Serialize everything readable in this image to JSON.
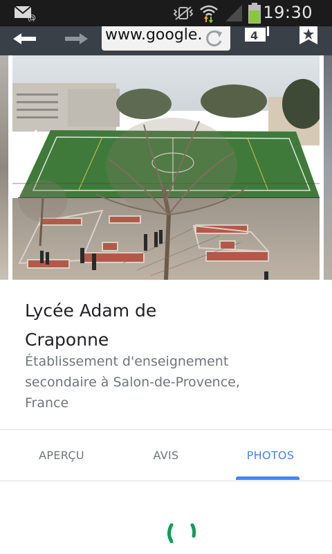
{
  "status_bar": {
    "time": "19:30",
    "icons": [
      "email-notification-icon",
      "vibrate-icon",
      "wifi-icon",
      "signal-icon",
      "battery-icon"
    ],
    "battery_color": "#8cc63f"
  },
  "browser": {
    "url": "www.google.",
    "tab_count": "4",
    "icons": [
      "back-arrow-icon",
      "forward-arrow-icon",
      "reload-icon",
      "tabs-icon",
      "bookmark-icon"
    ]
  },
  "place": {
    "name": "Lycée Adam de Craponne",
    "description": "Établissement d'enseignement secondaire à Salon-de-Provence, France"
  },
  "tabs": [
    {
      "label": "APERÇU",
      "active": false
    },
    {
      "label": "AVIS",
      "active": false
    },
    {
      "label": "PHOTOS",
      "active": true
    }
  ],
  "colors": {
    "accent": "#4285f4",
    "toolbar": "#3a4048",
    "spinner": "#0f9d58"
  }
}
